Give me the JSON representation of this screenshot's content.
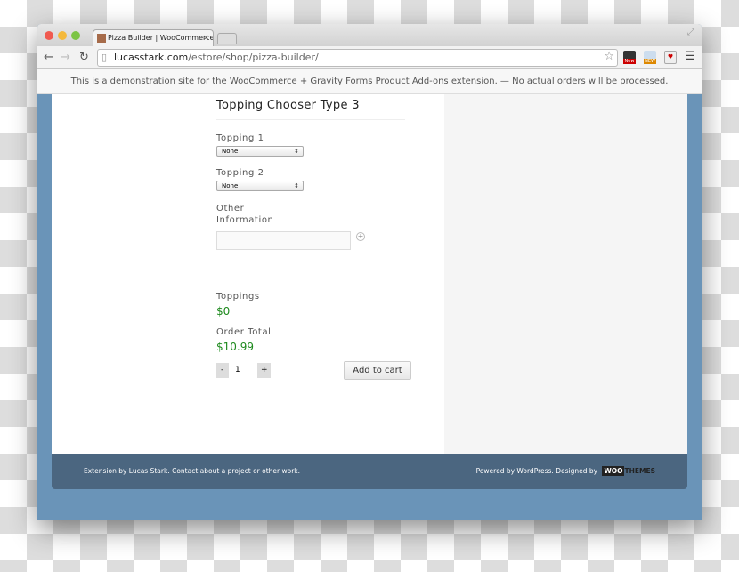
{
  "browser": {
    "tab_title": "Pizza Builder | WooCommerce",
    "url_domain": "lucasstark.com",
    "url_path": "/estore/shop/pizza-builder/",
    "extension_badges": [
      "New",
      "NEW"
    ]
  },
  "notice": "This is a demonstration site for the WooCommerce + Gravity Forms Product Add-ons extension. — No actual orders will be processed.",
  "form": {
    "title": "Topping Chooser Type 3",
    "topping1": {
      "label": "Topping 1",
      "value": "None"
    },
    "topping2": {
      "label": "Topping 2",
      "value": "None"
    },
    "other": {
      "label_line1": "Other",
      "label_line2": "Information",
      "value": ""
    },
    "toppings": {
      "label": "Toppings",
      "value": "$0"
    },
    "total": {
      "label": "Order Total",
      "value": "$10.99"
    },
    "qty": {
      "minus": "-",
      "value": "1",
      "plus": "+"
    },
    "add_to_cart": "Add to cart"
  },
  "footer": {
    "left": "Extension by Lucas Stark. Contact about a project or other work.",
    "right": "Powered by WordPress. Designed by",
    "logo": "WOOTHEMES"
  },
  "colors": {
    "price": "#1e8a1e",
    "footer": "#4b6680",
    "background": "#6a94b8"
  }
}
